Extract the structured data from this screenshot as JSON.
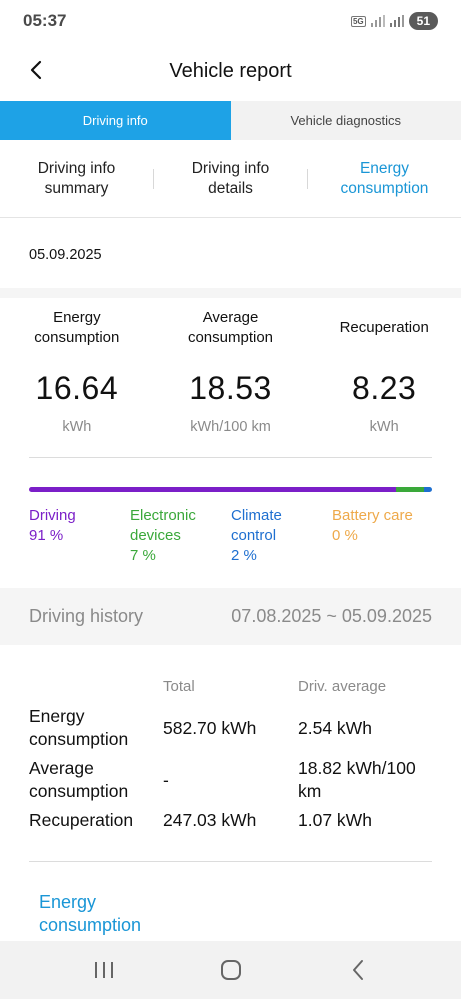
{
  "status_bar": {
    "time": "05:37",
    "network_label": "5G",
    "battery": "51"
  },
  "header": {
    "title": "Vehicle report",
    "back_icon": "chevron-left-icon"
  },
  "main_tabs": [
    {
      "label": "Driving info",
      "active": true
    },
    {
      "label": "Vehicle diagnostics",
      "active": false
    }
  ],
  "sub_tabs": [
    {
      "label_line1": "Driving info",
      "label_line2": "summary",
      "active": false
    },
    {
      "label_line1": "Driving info",
      "label_line2": "details",
      "active": false
    },
    {
      "label_line1": "Energy",
      "label_line2": "consumption",
      "active": true
    }
  ],
  "report_date": "05.09.2025",
  "summary": [
    {
      "label_line1": "Energy",
      "label_line2": "consumption",
      "value": "16.64",
      "unit": "kWh"
    },
    {
      "label_line1": "Average",
      "label_line2": "consumption",
      "value": "18.53",
      "unit": "kWh/100 km"
    },
    {
      "label_line1": "Recuperation",
      "label_line2": "",
      "value": "8.23",
      "unit": "kWh"
    }
  ],
  "breakdown": [
    {
      "name_line1": "Driving",
      "name_line2": "",
      "percent_text": "91 %",
      "percent": 91,
      "color": "#7b1fc8"
    },
    {
      "name_line1": "Electronic",
      "name_line2": "devices",
      "percent_text": "7 %",
      "percent": 7,
      "color": "#3aa83a"
    },
    {
      "name_line1": "Climate",
      "name_line2": "control",
      "percent_text": "2 %",
      "percent": 2,
      "color": "#1e6fd0"
    },
    {
      "name_line1": "Battery care",
      "name_line2": "",
      "percent_text": "0 %",
      "percent": 0,
      "color": "#eea94a"
    }
  ],
  "history": {
    "title": "Driving history",
    "range": "07.08.2025 ~ 05.09.2025",
    "col_total": "Total",
    "col_avg": "Driv. average",
    "rows": [
      {
        "label_line1": "Energy",
        "label_line2": "consumption",
        "total": "582.70 kWh",
        "avg_line1": "2.54 kWh",
        "avg_line2": ""
      },
      {
        "label_line1": "Average",
        "label_line2": "consumption",
        "total": "-",
        "avg_line1": "18.82 kWh/100",
        "avg_line2": "km"
      },
      {
        "label_line1": "Recuperation",
        "label_line2": "",
        "total": "247.03 kWh",
        "avg_line1": "1.07 kWh",
        "avg_line2": ""
      }
    ]
  },
  "section_link": {
    "line1": "Energy",
    "line2": "consumption"
  },
  "nav": {
    "recent_icon": "recent-apps-icon",
    "home_icon": "home-icon",
    "back_icon": "back-icon"
  },
  "colors": {
    "accent": "#1ea2e6",
    "accent_text": "#1a96d6"
  }
}
